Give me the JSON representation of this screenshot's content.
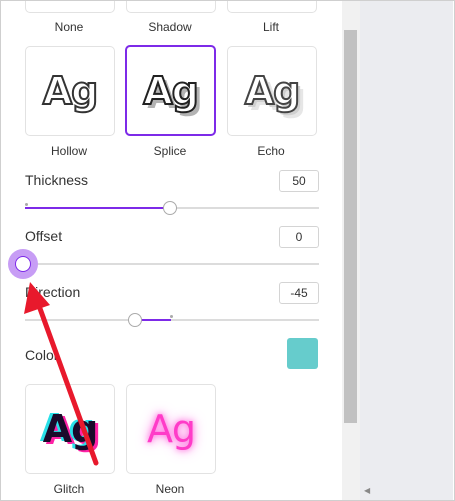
{
  "effects": {
    "top_row": [
      "None",
      "Shadow",
      "Lift"
    ],
    "row2": [
      {
        "label": "Hollow",
        "preview": "Ag",
        "selected": false
      },
      {
        "label": "Splice",
        "preview": "Ag",
        "selected": true
      },
      {
        "label": "Echo",
        "preview": "Ag",
        "selected": false
      }
    ],
    "row3": [
      {
        "label": "Glitch",
        "preview": "Ag"
      },
      {
        "label": "Neon",
        "preview": "Ag"
      }
    ]
  },
  "controls": {
    "thickness": {
      "label": "Thickness",
      "value": "50",
      "fraction": 0.5
    },
    "offset": {
      "label": "Offset",
      "value": "0",
      "fraction": 0.0
    },
    "direction": {
      "label": "Direction",
      "value": "-45"
    },
    "color": {
      "label": "Color",
      "swatch": "#66cccc"
    }
  },
  "colors": {
    "accent": "#7d2ae8",
    "annotation_arrow": "#e8192c"
  }
}
